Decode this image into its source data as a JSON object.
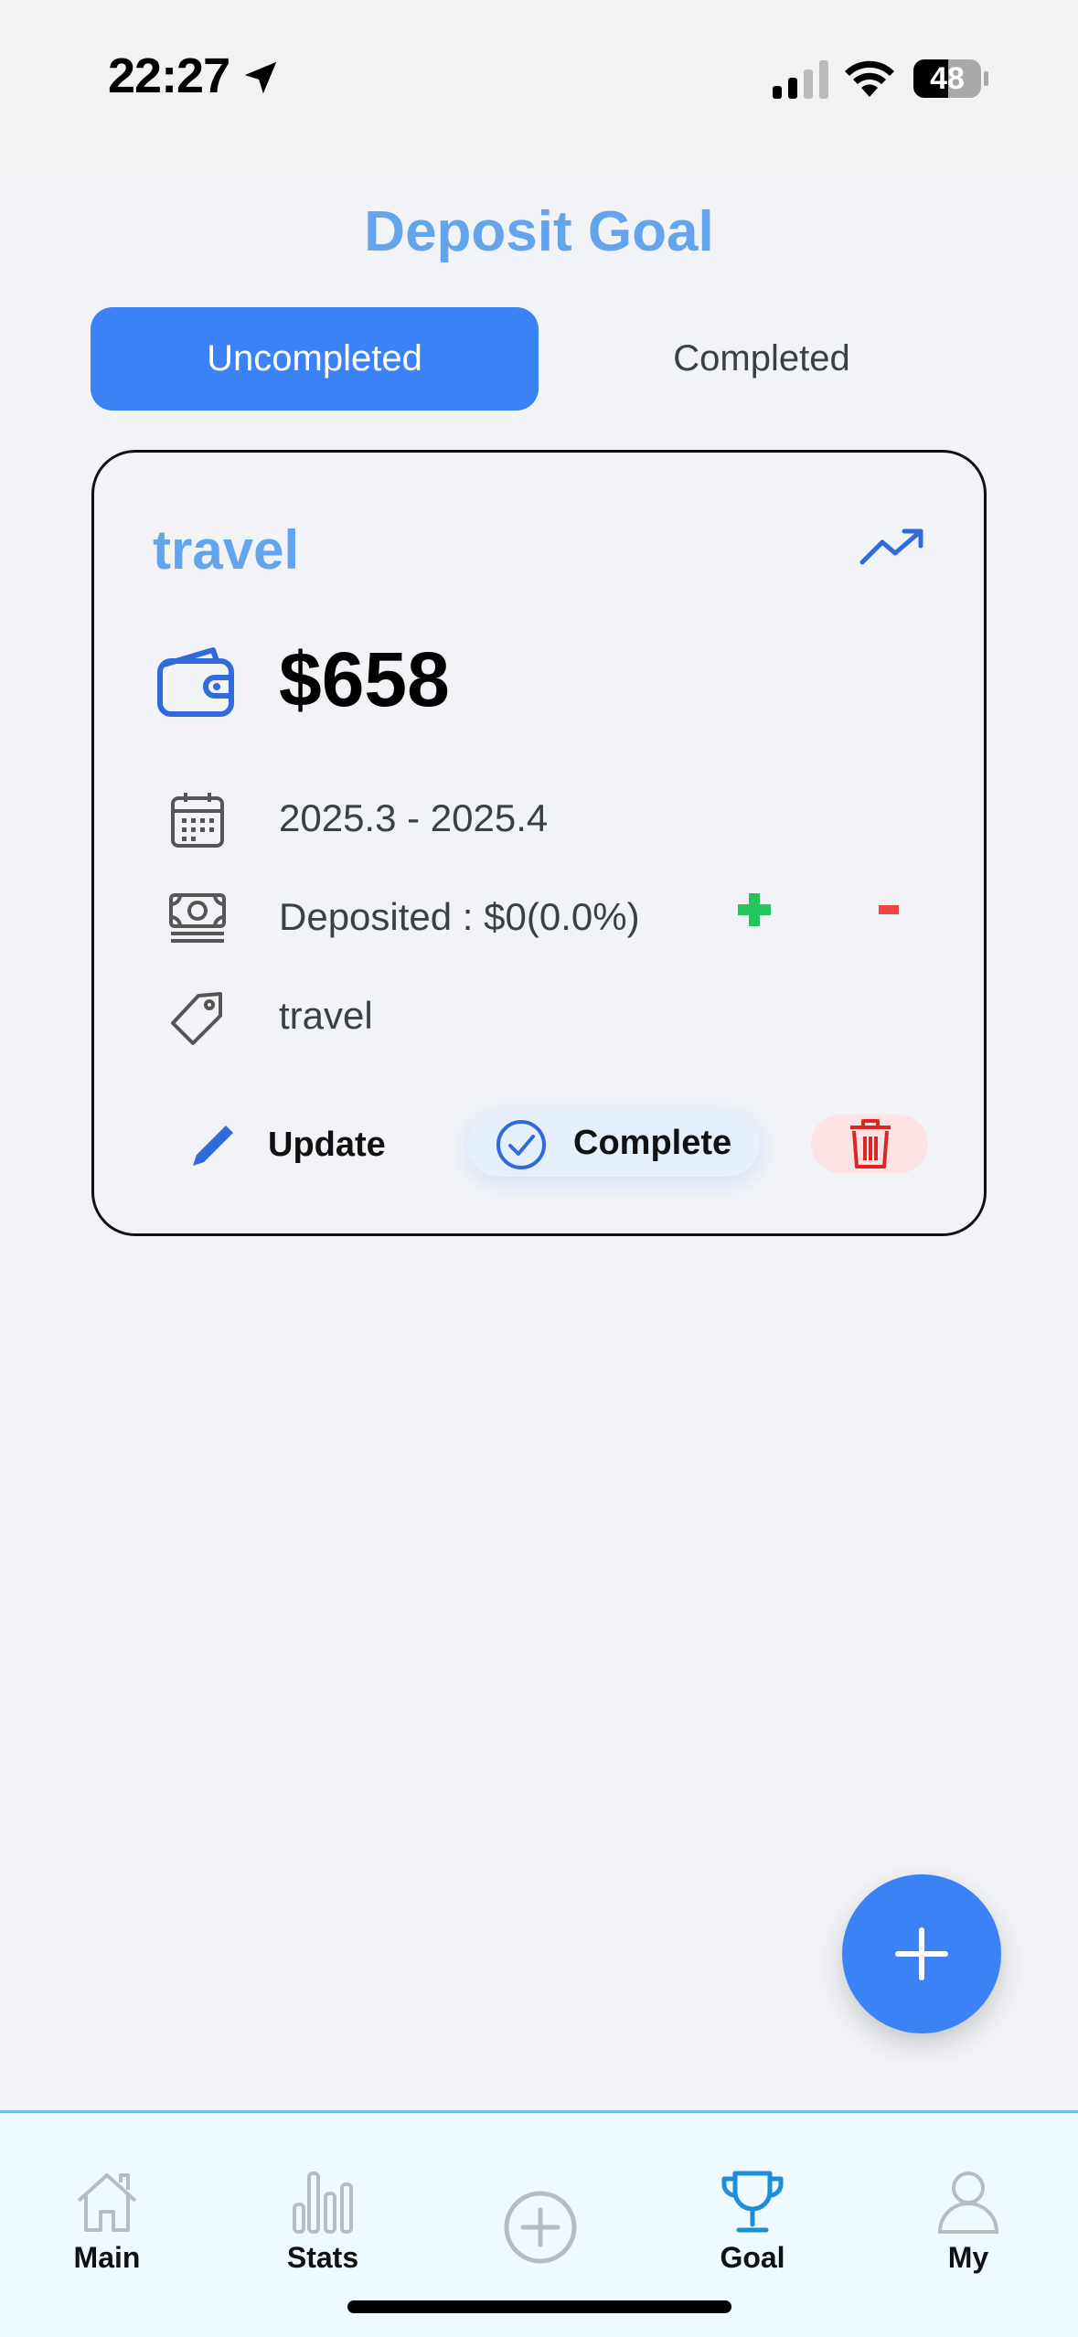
{
  "status_bar": {
    "time": "22:27",
    "battery": "48",
    "icons": [
      "location-arrow-icon",
      "cellular-signal-icon",
      "wifi-icon",
      "battery-icon"
    ]
  },
  "header": {
    "title": "Deposit Goal"
  },
  "tabs": [
    {
      "label": "Uncompleted",
      "active": true
    },
    {
      "label": "Completed",
      "active": false
    }
  ],
  "goal_card": {
    "title": "travel",
    "amount": "$658",
    "period": "2025.3 - 2025.4",
    "deposited": "Deposited : $0(0.0%)",
    "tag": "travel",
    "actions": {
      "update_label": "Update",
      "complete_label": "Complete"
    }
  },
  "nav": {
    "items": [
      {
        "label": "Main",
        "icon": "home-icon"
      },
      {
        "label": "Stats",
        "icon": "bar-chart-icon"
      },
      {
        "label": "",
        "icon": "add-circle-icon"
      },
      {
        "label": "Goal",
        "icon": "trophy-icon",
        "active": true
      },
      {
        "label": "My",
        "icon": "user-icon"
      }
    ]
  },
  "colors": {
    "accent": "#3b82f6",
    "title_blue": "#63a4ec",
    "positive": "#22c55e",
    "negative": "#ef4444",
    "background": "#f1f3f6",
    "tab_bar_bg": "#eefaff"
  }
}
